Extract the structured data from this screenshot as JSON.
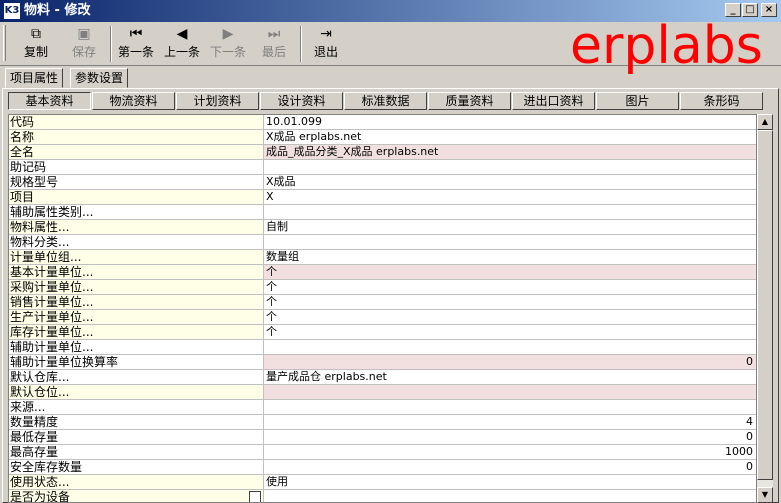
{
  "window": {
    "icon_label": "K3",
    "title": "物料 - 修改",
    "min": "_",
    "max": "□",
    "close": "×"
  },
  "toolbar": {
    "copy": "复制",
    "save": "保存",
    "first": "第一条",
    "prev": "上一条",
    "next": "下一条",
    "last": "最后",
    "exit": "退出"
  },
  "watermark": "erplabs",
  "tabs_top": [
    "项目属性",
    "参数设置"
  ],
  "tabs_inner": [
    "基本资料",
    "物流资料",
    "计划资料",
    "设计资料",
    "标准数据",
    "质量资料",
    "进出口资料",
    "图片",
    "条形码"
  ],
  "rows": [
    {
      "label": "代码",
      "value": ""
    },
    {
      "label": "名称",
      "value": "X成品 erplabs.net"
    },
    {
      "label": "全名",
      "value": "成品_成品分类_X成品 erplabs.net"
    },
    {
      "label": "助记码",
      "value": ""
    },
    {
      "label": "规格型号",
      "value": "X成品"
    },
    {
      "label": "项目",
      "value": "X"
    },
    {
      "label": "辅助属性类别...",
      "value": ""
    },
    {
      "label": "物料属性...",
      "value": "自制"
    },
    {
      "label": "物料分类...",
      "value": ""
    },
    {
      "label": "计量单位组...",
      "value": "数量组"
    },
    {
      "label": "基本计量单位...",
      "value": "个"
    },
    {
      "label": "采购计量单位...",
      "value": "个"
    },
    {
      "label": "销售计量单位...",
      "value": "个"
    },
    {
      "label": "生产计量单位...",
      "value": "个"
    },
    {
      "label": "库存计量单位...",
      "value": "个"
    },
    {
      "label": "辅助计量单位...",
      "value": ""
    },
    {
      "label": "辅助计量单位换算率",
      "value": "0"
    },
    {
      "label": "默认仓库...",
      "value": "量产成品仓 erplabs.net"
    },
    {
      "label": "默认仓位...",
      "value": ""
    },
    {
      "label": "来源...",
      "value": ""
    },
    {
      "label": "数量精度",
      "value": "4"
    },
    {
      "label": "最低存量",
      "value": "0"
    },
    {
      "label": "最高存量",
      "value": "1000"
    },
    {
      "label": "安全库存数量",
      "value": "0"
    },
    {
      "label": "使用状态...",
      "value": "使用"
    },
    {
      "label": "是否为设备",
      "value": ""
    }
  ],
  "code_value": "10.01.099",
  "colors": {
    "title_start": "#0a246a",
    "title_end": "#a6caf0",
    "watermark": "#ff0000",
    "label_highlight": "#ffffe8",
    "value_highlight": "#f2e0e0"
  },
  "scroll": {
    "up": "▲",
    "down": "▼"
  }
}
